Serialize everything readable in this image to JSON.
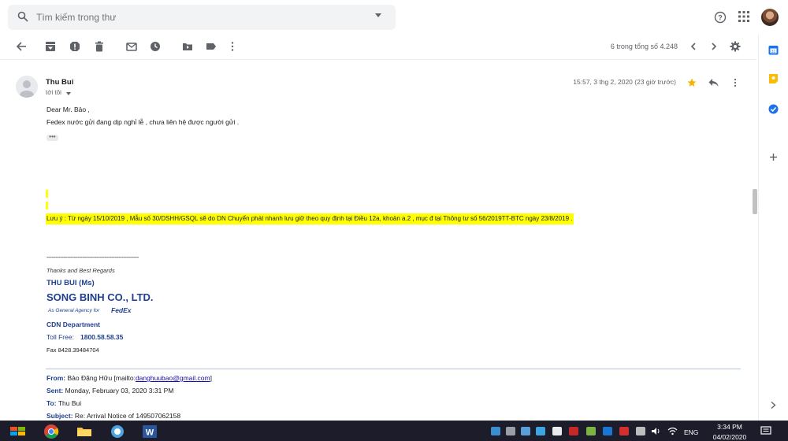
{
  "search": {
    "placeholder": "Tìm kiếm trong thư"
  },
  "toolbar": {
    "pager": "6 trong tổng số 4.248"
  },
  "message": {
    "sender": "Thu Bui",
    "recipient": "tới tôi",
    "date": "15:57, 3 thg 2, 2020 (23 giờ trước)",
    "greeting": "Dear Mr. Bảo ,",
    "line1": "Fedex nước gửi đang dịp nghỉ lễ , chưa liên hệ được người gửi .",
    "ellipsis": "•••",
    "note": "Lưu ý : Từ ngày 15/10/2019 , Mẫu số 30/DSHH/GSQL  sẽ do DN Chuyển phát nhanh lưu giữ theo  quy định tại  Điều 12a,  khoản a.2 , mục đ tại Thông tư số 56/2019TT-BTC ngày 23/8/2019 ."
  },
  "signature": {
    "rule": "------------------------------------------------------",
    "thanks": "Thanks and Best Regards",
    "name": "THU BUI  (Ms)",
    "company": "SONG BINH CO., LTD.",
    "agency": "As General Agency for",
    "agency_brand": "FedEx",
    "department": "CDN Department",
    "toll_label": "Toll Free:",
    "toll_number": "1800.58.58.35",
    "fax": "Fax  8428.39484704"
  },
  "quoted": {
    "from_label": "From:",
    "from_value": "Bảo Đặng Hữu [mailto:",
    "from_email": "danghuubao@gmail.com",
    "from_tail": "]",
    "sent_label": "Sent:",
    "sent_value": "Monday, February 03, 2020 3:31 PM",
    "to_label": "To:",
    "to_value": "Thu Bui",
    "subject_label": "Subject:",
    "subject_value": "Re: Arrival Notice of 149507062158"
  },
  "taskbar": {
    "lang": "ENG",
    "time": "3:34 PM",
    "date": "04/02/2020"
  },
  "colors": {
    "highlight": "#ffff00",
    "signature_blue": "#1f3f8f",
    "taskbar": "#1c1c2a",
    "star": "#f4b400"
  }
}
